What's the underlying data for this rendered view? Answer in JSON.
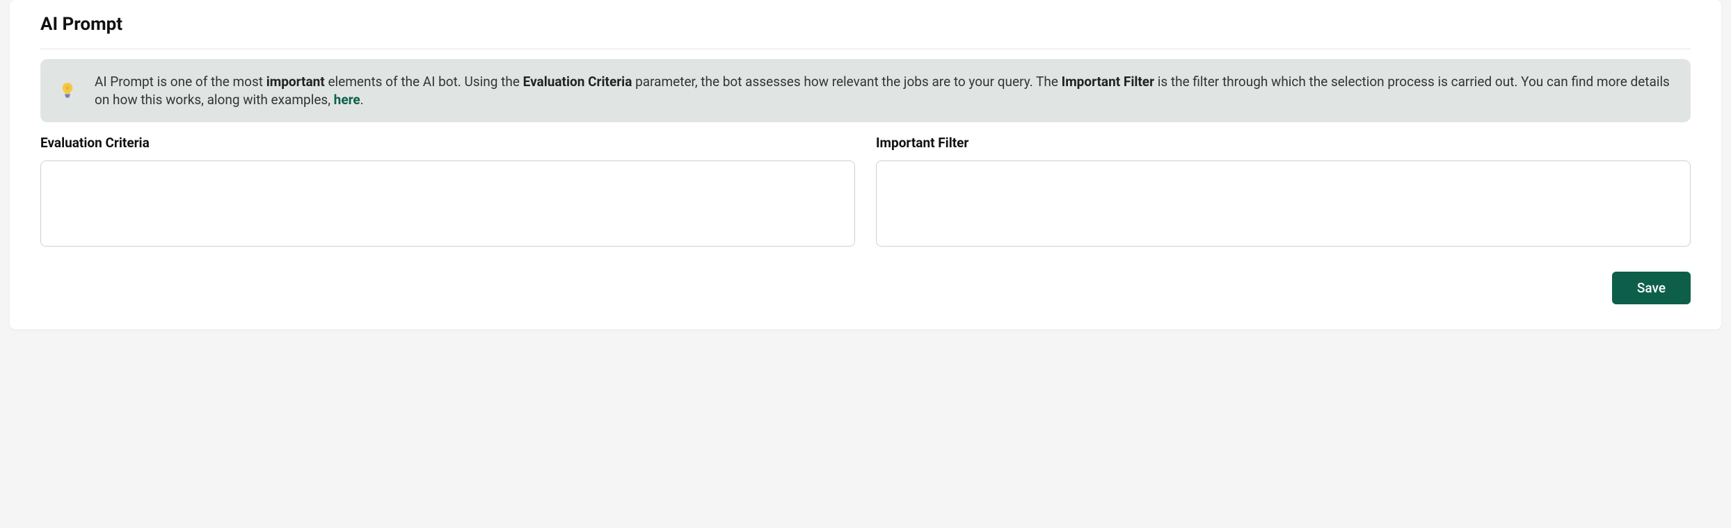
{
  "section": {
    "title": "AI Prompt"
  },
  "info": {
    "text_part1": "AI Prompt is one of the most ",
    "bold1": "important",
    "text_part2": " elements of the AI bot. Using the ",
    "bold2": "Evaluation Criteria",
    "text_part3": " parameter, the bot assesses how relevant the jobs are to your query. The ",
    "bold3": "Important Filter",
    "text_part4": " is the filter through which the selection process is carried out. You can find more details on how this works, along with examples, ",
    "link_text": "here",
    "text_part5": "."
  },
  "fields": {
    "evaluation": {
      "label": "Evaluation Criteria",
      "value": ""
    },
    "filter": {
      "label": "Important Filter",
      "value": ""
    }
  },
  "buttons": {
    "save": "Save"
  }
}
